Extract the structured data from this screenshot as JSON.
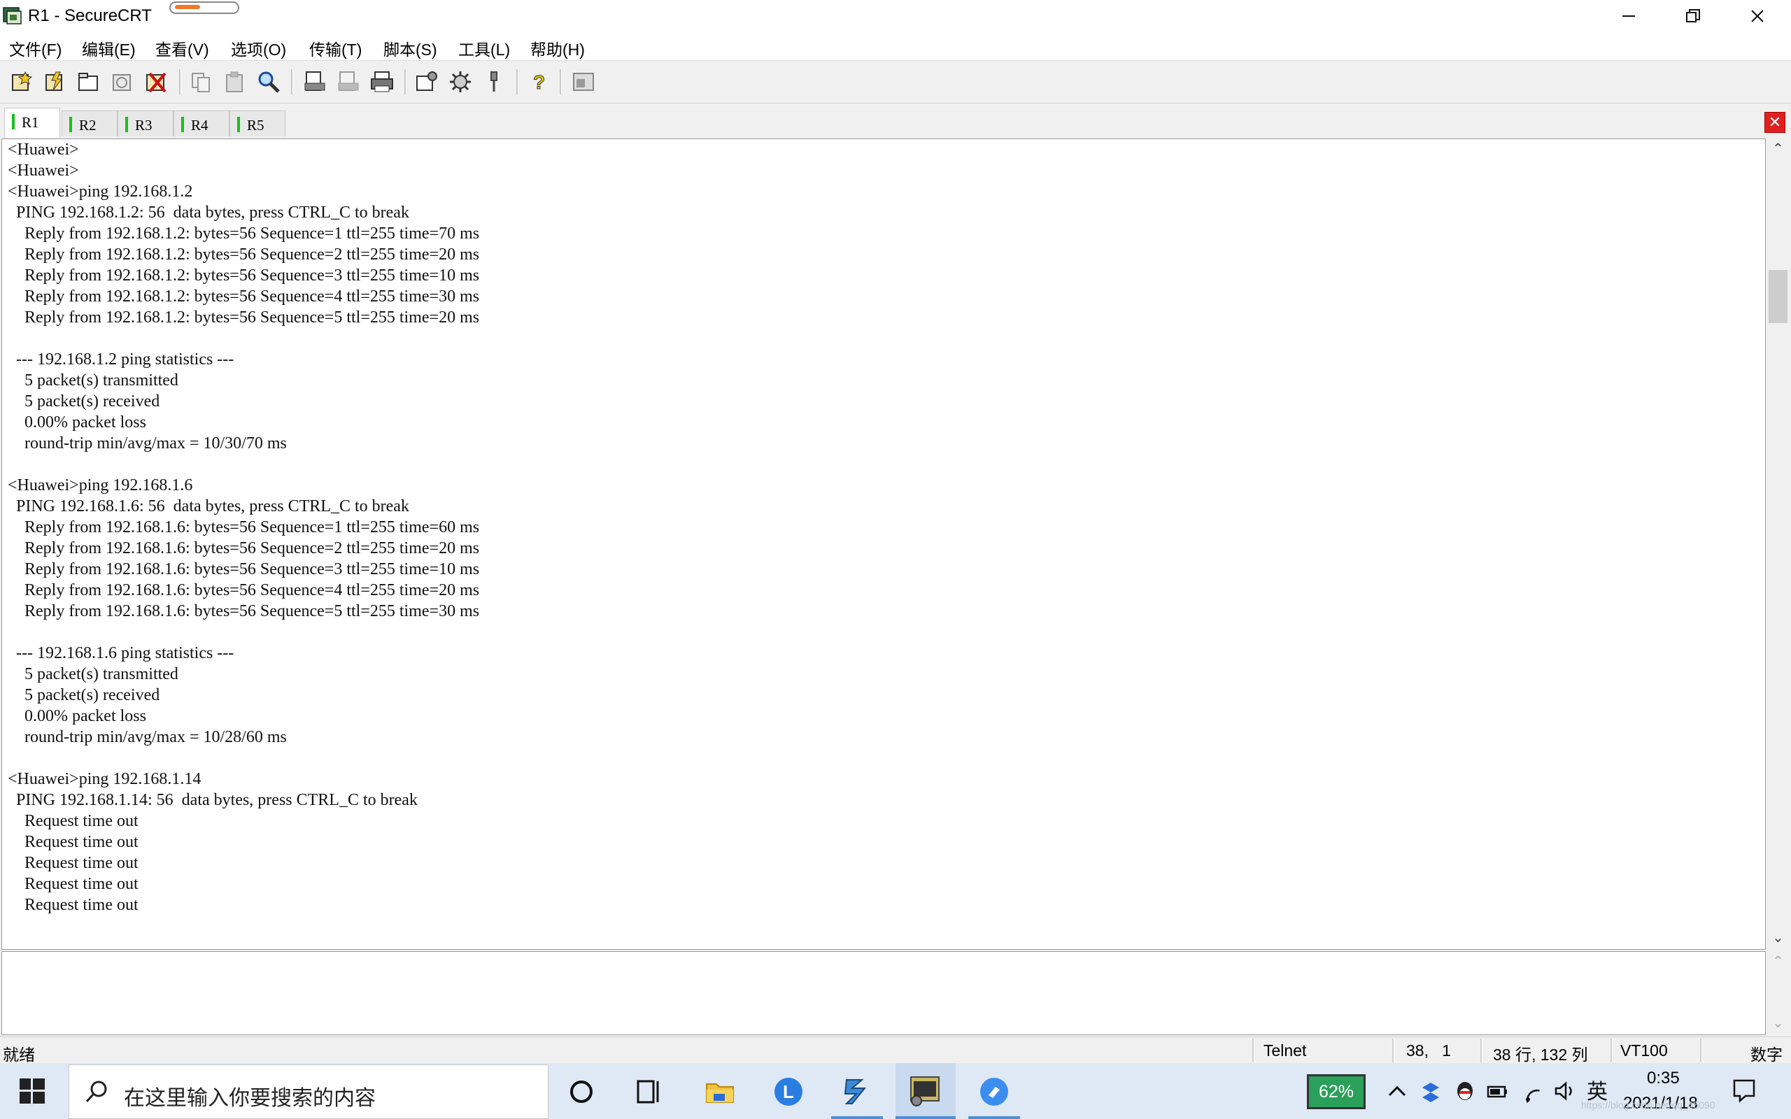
{
  "window": {
    "title": "R1 - SecureCRT",
    "colors": {
      "tab_marker": "#1bbf1b",
      "close_tab": "#e02020",
      "battery": "#2aa05a"
    }
  },
  "menu": [
    "文件(F)",
    "编辑(E)",
    "查看(V)",
    "选项(O)",
    "传输(T)",
    "脚本(S)",
    "工具(L)",
    "帮助(H)"
  ],
  "toolbar": {
    "icons": [
      "connect-icon",
      "quick-connect-icon",
      "connect-in-tab-icon",
      "reconnect-icon",
      "disconnect-icon",
      "copy-icon",
      "paste-icon",
      "find-icon",
      "print-setup-icon",
      "print-selection-icon",
      "print-icon",
      "session-options-icon",
      "global-options-icon",
      "keymap-icon",
      "help-icon",
      "sftp-icon"
    ]
  },
  "tabs": [
    {
      "label": "R1",
      "active": true
    },
    {
      "label": "R2",
      "active": false
    },
    {
      "label": "R3",
      "active": false
    },
    {
      "label": "R4",
      "active": false
    },
    {
      "label": "R5",
      "active": false
    }
  ],
  "terminal": {
    "lines": [
      "<Huawei>",
      "<Huawei>",
      "<Huawei>ping 192.168.1.2",
      "  PING 192.168.1.2: 56  data bytes, press CTRL_C to break",
      "    Reply from 192.168.1.2: bytes=56 Sequence=1 ttl=255 time=70 ms",
      "    Reply from 192.168.1.2: bytes=56 Sequence=2 ttl=255 time=20 ms",
      "    Reply from 192.168.1.2: bytes=56 Sequence=3 ttl=255 time=10 ms",
      "    Reply from 192.168.1.2: bytes=56 Sequence=4 ttl=255 time=30 ms",
      "    Reply from 192.168.1.2: bytes=56 Sequence=5 ttl=255 time=20 ms",
      "",
      "  --- 192.168.1.2 ping statistics ---",
      "    5 packet(s) transmitted",
      "    5 packet(s) received",
      "    0.00% packet loss",
      "    round-trip min/avg/max = 10/30/70 ms",
      "",
      "<Huawei>ping 192.168.1.6",
      "  PING 192.168.1.6: 56  data bytes, press CTRL_C to break",
      "    Reply from 192.168.1.6: bytes=56 Sequence=1 ttl=255 time=60 ms",
      "    Reply from 192.168.1.6: bytes=56 Sequence=2 ttl=255 time=20 ms",
      "    Reply from 192.168.1.6: bytes=56 Sequence=3 ttl=255 time=10 ms",
      "    Reply from 192.168.1.6: bytes=56 Sequence=4 ttl=255 time=20 ms",
      "    Reply from 192.168.1.6: bytes=56 Sequence=5 ttl=255 time=30 ms",
      "",
      "  --- 192.168.1.6 ping statistics ---",
      "    5 packet(s) transmitted",
      "    5 packet(s) received",
      "    0.00% packet loss",
      "    round-trip min/avg/max = 10/28/60 ms",
      "",
      "<Huawei>ping 192.168.1.14",
      "  PING 192.168.1.14: 56  data bytes, press CTRL_C to break",
      "    Request time out",
      "    Request time out",
      "    Request time out",
      "    Request time out",
      "    Request time out"
    ]
  },
  "status": {
    "ready": "就绪",
    "protocol": "Telnet",
    "cursor": "38,   1",
    "size": "38 行, 132 列",
    "emulation": "VT100",
    "numlock": "数字"
  },
  "taskbar": {
    "search_placeholder": "在这里输入你要搜索的内容",
    "battery": "62%",
    "ime": "英",
    "time": "0:35",
    "date": "2021/1/18",
    "watermark": "https://blog.csdn.net/qq_45090"
  }
}
